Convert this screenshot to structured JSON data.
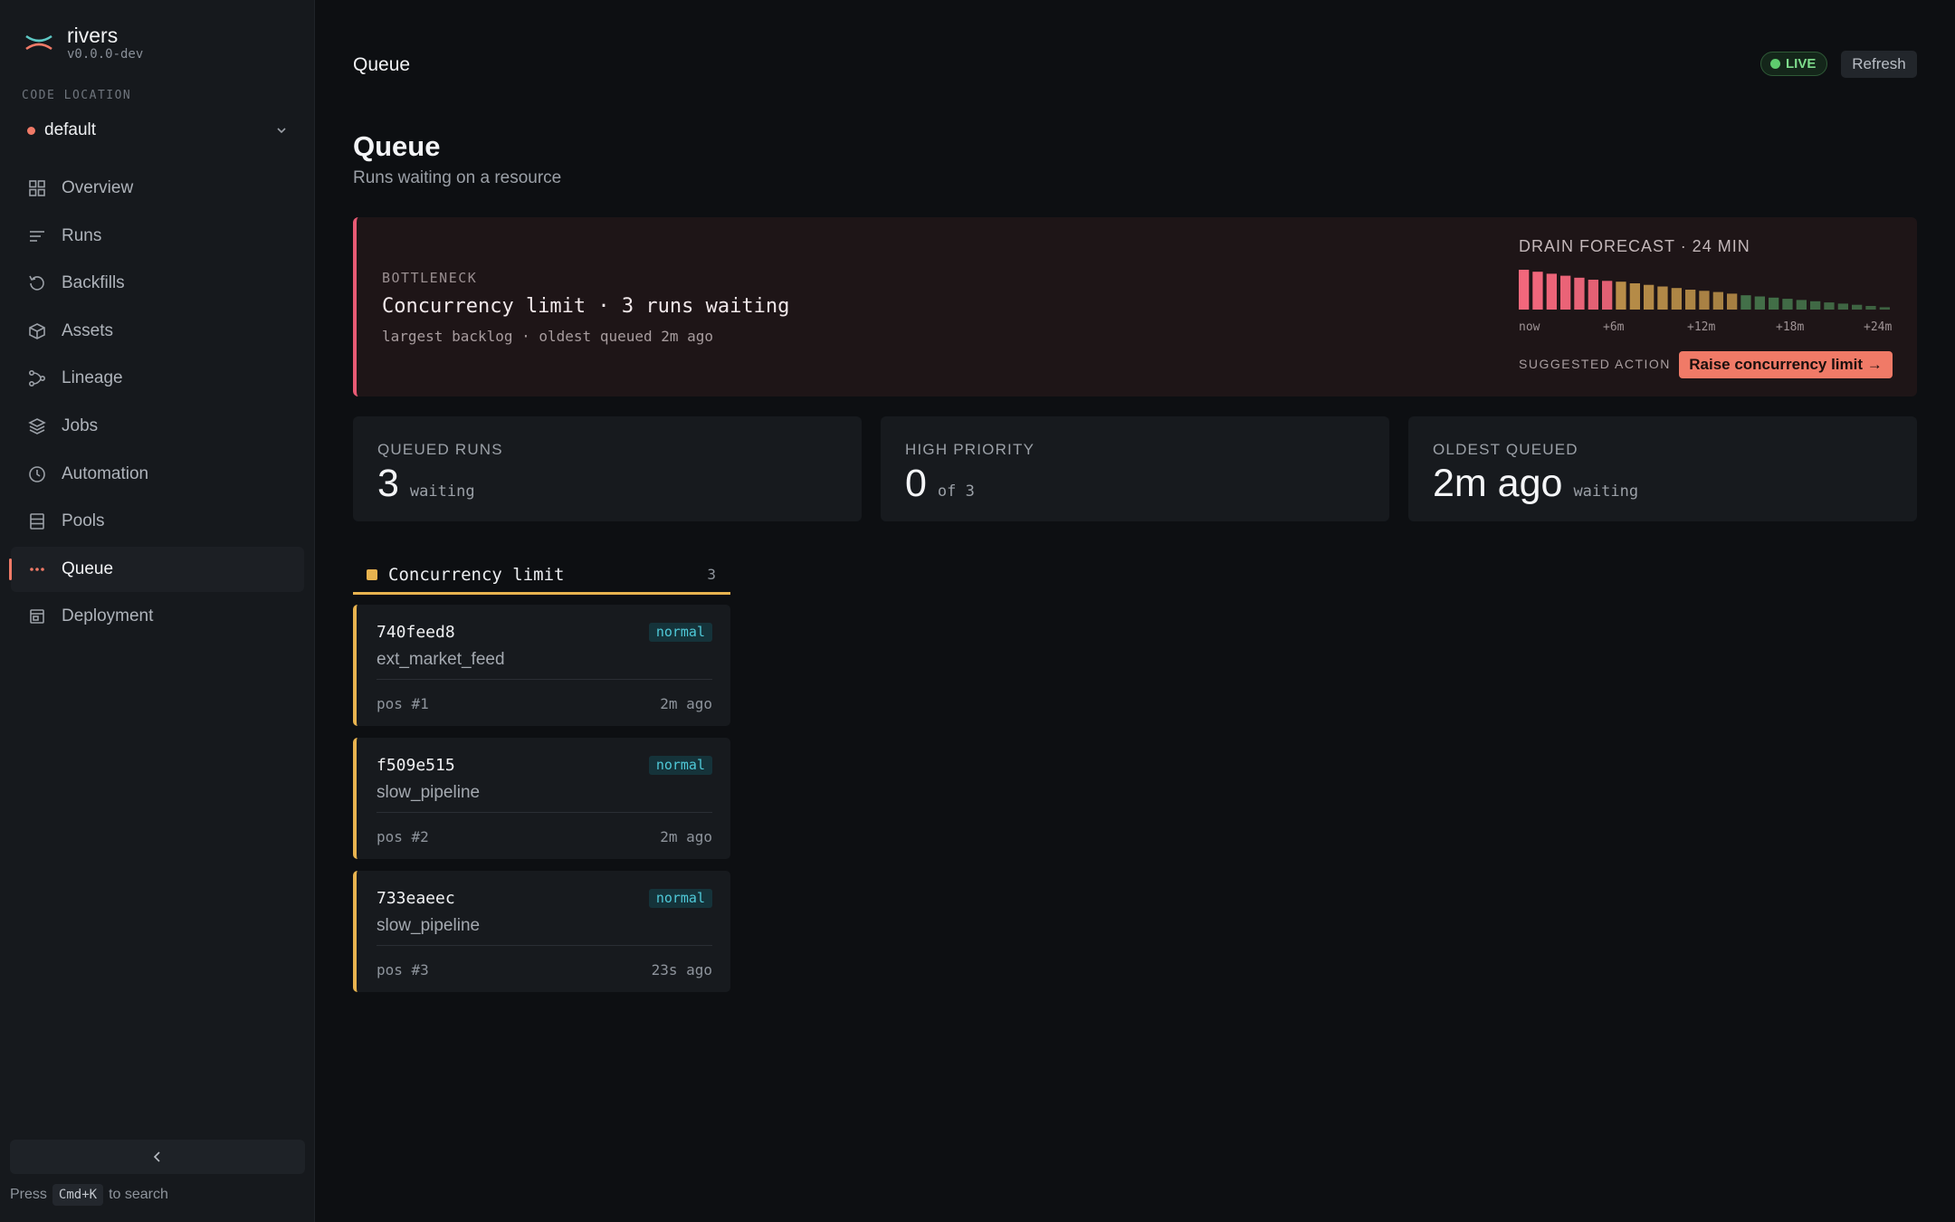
{
  "app": {
    "name": "rivers",
    "version": "v0.0.0-dev"
  },
  "code_location": {
    "label": "CODE LOCATION",
    "name": "default",
    "status_color": "#f07a67"
  },
  "nav": {
    "items": [
      {
        "label": "Overview",
        "icon": "grid-icon"
      },
      {
        "label": "Runs",
        "icon": "list-icon"
      },
      {
        "label": "Backfills",
        "icon": "history-icon"
      },
      {
        "label": "Assets",
        "icon": "cube-icon"
      },
      {
        "label": "Lineage",
        "icon": "lineage-icon"
      },
      {
        "label": "Jobs",
        "icon": "layers-icon"
      },
      {
        "label": "Automation",
        "icon": "clock-icon"
      },
      {
        "label": "Pools",
        "icon": "database-icon"
      },
      {
        "label": "Queue",
        "icon": "dots-icon",
        "active": true
      },
      {
        "label": "Deployment",
        "icon": "deployment-icon"
      }
    ]
  },
  "search_hint": {
    "prefix": "Press",
    "shortcut": "Cmd+K",
    "suffix": "to search"
  },
  "topbar": {
    "title": "Queue",
    "live_label": "LIVE",
    "refresh_label": "Refresh"
  },
  "page": {
    "title": "Queue",
    "subtitle": "Runs waiting on a resource"
  },
  "bottleneck": {
    "label": "BOTTLENECK",
    "title": "Concurrency limit · 3 runs waiting",
    "subtitle": "largest backlog · oldest queued 2m ago",
    "forecast_label": "DRAIN FORECAST · 24 MIN",
    "forecast_ticks": [
      "now",
      "+6m",
      "+12m",
      "+18m",
      "+24m"
    ],
    "forecast_levels": [
      1.0,
      0.95,
      0.9,
      0.85,
      0.8,
      0.75,
      0.72,
      0.7,
      0.66,
      0.62,
      0.58,
      0.54,
      0.5,
      0.47,
      0.44,
      0.4,
      0.36,
      0.33,
      0.3,
      0.27,
      0.24,
      0.21,
      0.18,
      0.15,
      0.12,
      0.09,
      0.06
    ],
    "suggested_label": "SUGGESTED ACTION",
    "suggested_action": "Raise concurrency limit →",
    "accent": "#e85a74"
  },
  "stats": [
    {
      "label": "QUEUED RUNS",
      "value": "3",
      "unit": "waiting"
    },
    {
      "label": "HIGH PRIORITY",
      "value": "0",
      "unit": "of 3"
    },
    {
      "label": "OLDEST QUEUED",
      "value": "2m ago",
      "unit": "waiting"
    }
  ],
  "lane": {
    "name": "Concurrency limit",
    "count": "3",
    "color": "#e8b34f",
    "cards": [
      {
        "id": "740feed8",
        "priority": "normal",
        "job": "ext_market_feed",
        "position": "pos #1",
        "age": "2m ago"
      },
      {
        "id": "f509e515",
        "priority": "normal",
        "job": "slow_pipeline",
        "position": "pos #2",
        "age": "2m ago"
      },
      {
        "id": "733eaeec",
        "priority": "normal",
        "job": "slow_pipeline",
        "position": "pos #3",
        "age": "23s ago"
      }
    ]
  }
}
